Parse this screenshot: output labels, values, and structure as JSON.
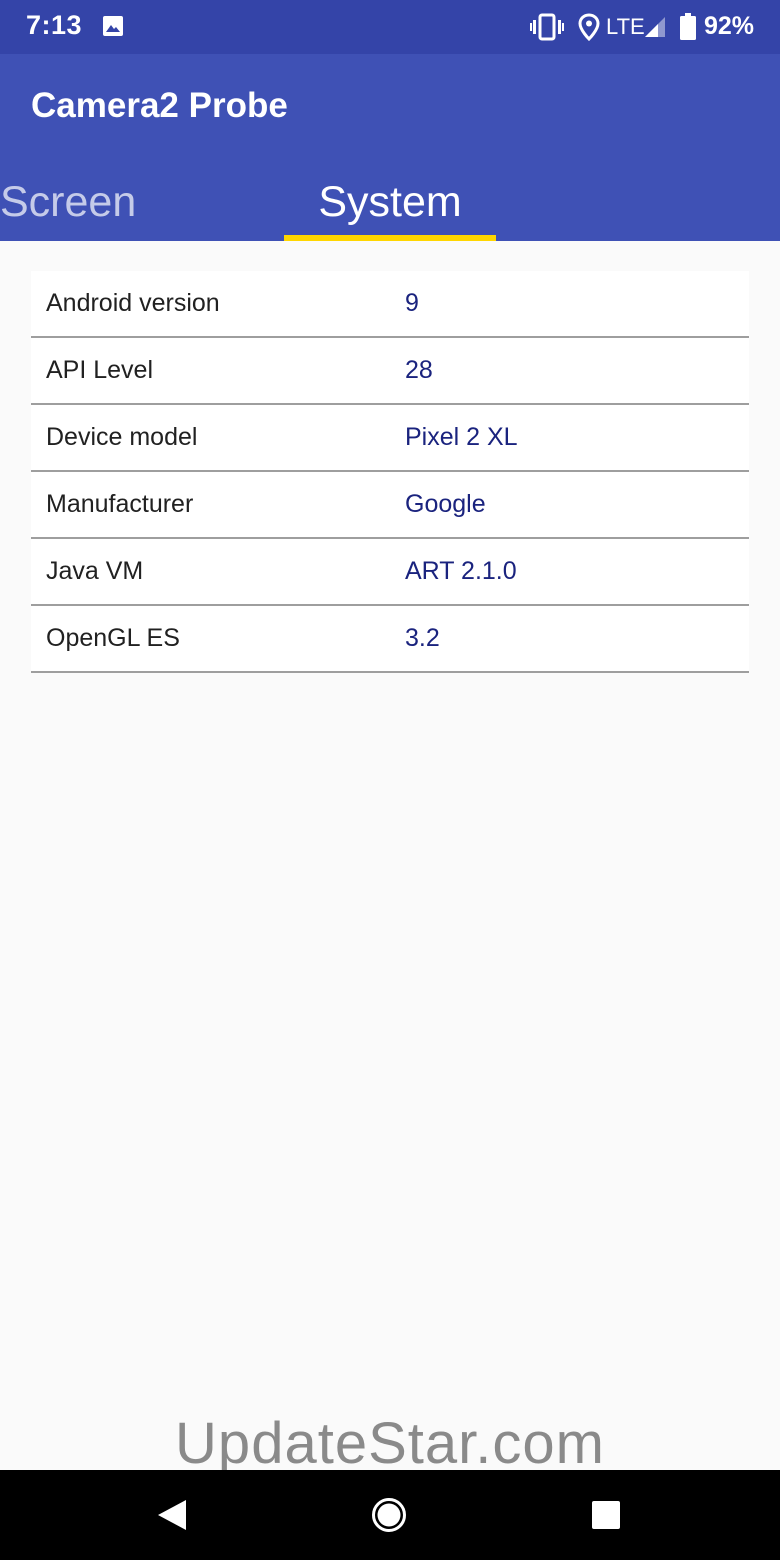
{
  "status_bar": {
    "time": "7:13",
    "network": "LTE",
    "battery": "92%",
    "icons": [
      "photo-icon",
      "vibrate-icon",
      "location-icon",
      "signal-icon",
      "battery-icon"
    ]
  },
  "app": {
    "title": "Camera2 Probe",
    "tabs": [
      {
        "label": "Screen",
        "selected": false
      },
      {
        "label": "System",
        "selected": true
      }
    ]
  },
  "system_info": {
    "rows": [
      {
        "label": "Android version",
        "value": "9"
      },
      {
        "label": "API Level",
        "value": "28"
      },
      {
        "label": "Device model",
        "value": "Pixel 2 XL"
      },
      {
        "label": "Manufacturer",
        "value": "Google"
      },
      {
        "label": "Java VM",
        "value": "ART 2.1.0"
      },
      {
        "label": "OpenGL ES",
        "value": "3.2"
      }
    ]
  },
  "watermark": "UpdateStar.com",
  "nav_bar": {
    "icons": [
      "back-icon",
      "home-icon",
      "recents-icon"
    ]
  },
  "colors": {
    "status_bar": "#3444a8",
    "app_bar": "#3f51b5",
    "tab_indicator": "#ffd600",
    "value_text": "#1a237e",
    "background": "#fafafa"
  }
}
